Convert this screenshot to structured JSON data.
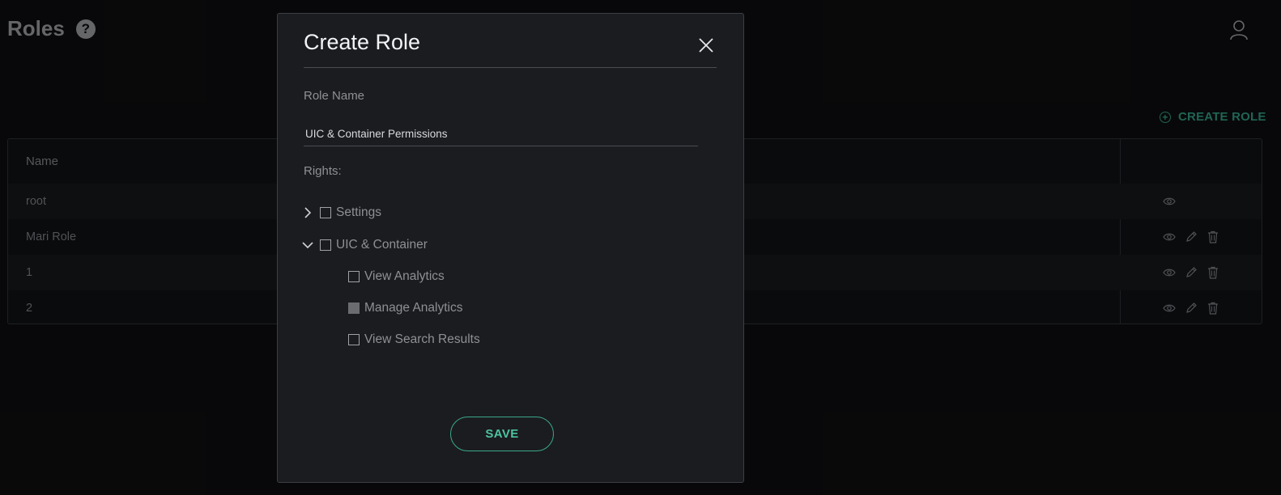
{
  "page": {
    "title": "Roles",
    "help_icon": "question-circle-icon",
    "help_glyph": "?",
    "user_icon": "user-icon",
    "create_role_label": "CREATE ROLE",
    "create_role_icon": "plus-circle-icon"
  },
  "table": {
    "columns": [
      "Name"
    ],
    "rows": [
      {
        "name": "root",
        "actions": [
          "view"
        ]
      },
      {
        "name": "Mari Role",
        "actions": [
          "view",
          "edit",
          "delete"
        ]
      },
      {
        "name": "1",
        "actions": [
          "view",
          "edit",
          "delete"
        ]
      },
      {
        "name": "2",
        "actions": [
          "view",
          "edit",
          "delete"
        ]
      }
    ]
  },
  "modal": {
    "title": "Create Role",
    "close_icon": "close-icon",
    "role_name_label": "Role Name",
    "role_name_value": "UIC & Container Permissions",
    "rights_label": "Rights:",
    "rights": [
      {
        "label": "Settings",
        "expanded": false,
        "checked": false
      },
      {
        "label": "UIC & Container",
        "expanded": true,
        "checked": false,
        "children": [
          {
            "label": "View Analytics",
            "checked": false
          },
          {
            "label": "Manage Analytics",
            "checked": true
          },
          {
            "label": "View Search Results",
            "checked": false
          }
        ]
      }
    ],
    "save_label": "SAVE"
  },
  "colors": {
    "accent": "#3aa88a",
    "background": "#0c0c0e",
    "modal_bg": "#1b1c20"
  }
}
